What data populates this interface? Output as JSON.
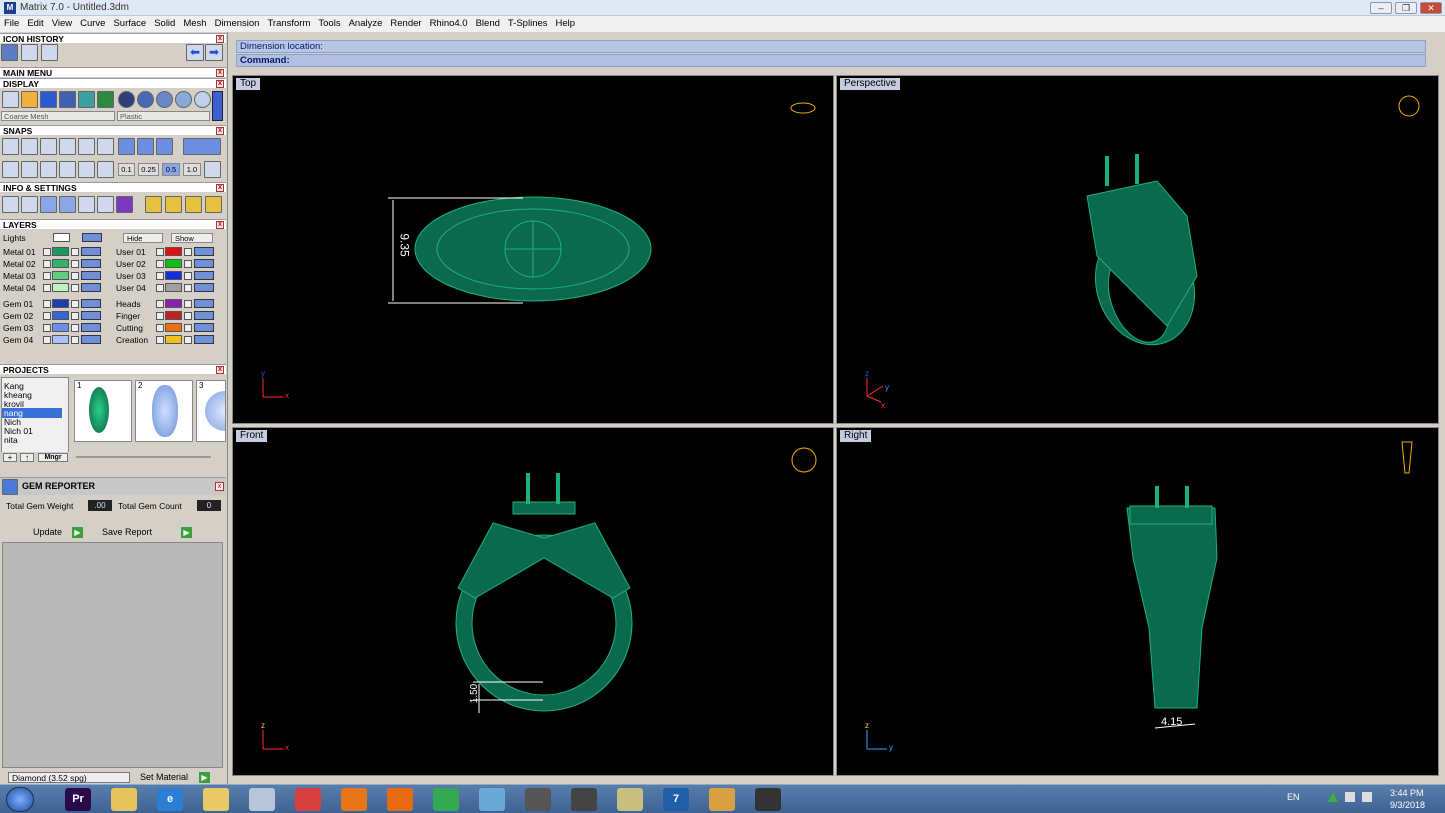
{
  "app": {
    "title": "Matrix 7.0 - Untitled.3dm",
    "icon": "matrix-app-icon"
  },
  "menu": [
    "File",
    "Edit",
    "View",
    "Curve",
    "Surface",
    "Solid",
    "Mesh",
    "Dimension",
    "Transform",
    "Tools",
    "Analyze",
    "Render",
    "Rhino4.0",
    "Blend",
    "T-Splines",
    "Help"
  ],
  "panels": {
    "icon_history": "ICON HISTORY",
    "main_menu": "MAIN MENU",
    "display": "DISPLAY",
    "snaps": "SNAPS",
    "info": "INFO & SETTINGS",
    "layers": "LAYERS",
    "projects": "PROJECTS",
    "gem_reporter": "GEM REPORTER"
  },
  "display": {
    "mesh": "Coarse Mesh",
    "material": "Plastic"
  },
  "snaps": {
    "values": [
      "0.1",
      "0.25",
      "0.5",
      "1.0"
    ]
  },
  "layers": {
    "lights": "Lights",
    "hide": "Hide",
    "show": "Show",
    "left": [
      {
        "name": "Metal 01",
        "color": "#1a9a5e"
      },
      {
        "name": "Metal 02",
        "color": "#33b36b"
      },
      {
        "name": "Metal 03",
        "color": "#5fd07f"
      },
      {
        "name": "Metal 04",
        "color": "#bff2c4"
      }
    ],
    "right": [
      {
        "name": "User 01",
        "color": "#e01010"
      },
      {
        "name": "User 02",
        "color": "#10c010"
      },
      {
        "name": "User 03",
        "color": "#1030e0"
      },
      {
        "name": "User 04",
        "color": "#a0a0a0"
      }
    ],
    "left2": [
      {
        "name": "Gem 01",
        "color": "#1e3fb0"
      },
      {
        "name": "Gem 02",
        "color": "#3b63d6"
      },
      {
        "name": "Gem 03",
        "color": "#6a8ff0"
      },
      {
        "name": "Gem 04",
        "color": "#aac0ff"
      }
    ],
    "right2": [
      {
        "name": "Heads",
        "color": "#8a20b0"
      },
      {
        "name": "Finger",
        "color": "#c02020"
      },
      {
        "name": "Cutting",
        "color": "#f07010"
      },
      {
        "name": "Creation",
        "color": "#f0c020"
      }
    ]
  },
  "projects": {
    "list": [
      "Kang",
      "kheang",
      "krovil",
      "nang",
      "Nich",
      "Nich 01",
      "nita"
    ],
    "selected": "nang",
    "thumbs": [
      "1",
      "2",
      "3"
    ],
    "mngr": "Mngr"
  },
  "gem_reporter": {
    "weight_label": "Total Gem Weight",
    "weight": ".00",
    "count_label": "Total Gem Count",
    "count": "0",
    "update": "Update",
    "save": "Save Report"
  },
  "material": {
    "selected": "Diamond      (3.52 spg)",
    "set": "Set Material"
  },
  "command": {
    "line1": "Dimension location:",
    "line2": "Command:"
  },
  "viewports": {
    "top": "Top",
    "perspective": "Perspective",
    "front": "Front",
    "right": "Right"
  },
  "dims": {
    "top": "9.35",
    "front": "1.50",
    "right": "4.15"
  },
  "tray": {
    "lang": "EN",
    "time": "3:44 PM",
    "date": "9/3/2018"
  },
  "taskbar": [
    {
      "name": "premiere",
      "label": "Pr",
      "color": "#2a0a4a"
    },
    {
      "name": "folder",
      "label": "",
      "color": "#e6c35c"
    },
    {
      "name": "ie",
      "label": "e",
      "color": "#2a7fd4"
    },
    {
      "name": "explorer",
      "label": "",
      "color": "#e9c869"
    },
    {
      "name": "calculator",
      "label": "",
      "color": "#b8c4d8"
    },
    {
      "name": "snip",
      "label": "",
      "color": "#d84040"
    },
    {
      "name": "firefox",
      "label": "",
      "color": "#e8751a"
    },
    {
      "name": "media",
      "label": "",
      "color": "#e86a10"
    },
    {
      "name": "chrome",
      "label": "",
      "color": "#34a853"
    },
    {
      "name": "eraser",
      "label": "",
      "color": "#6aa8d8"
    },
    {
      "name": "tool",
      "label": "",
      "color": "#555"
    },
    {
      "name": "zbrush",
      "label": "",
      "color": "#444"
    },
    {
      "name": "notes",
      "label": "",
      "color": "#c8c080"
    },
    {
      "name": "matrix",
      "label": "7",
      "color": "#1e5fa8"
    },
    {
      "name": "paint",
      "label": "",
      "color": "#d8a040"
    },
    {
      "name": "rhino",
      "label": "",
      "color": "#333"
    }
  ]
}
